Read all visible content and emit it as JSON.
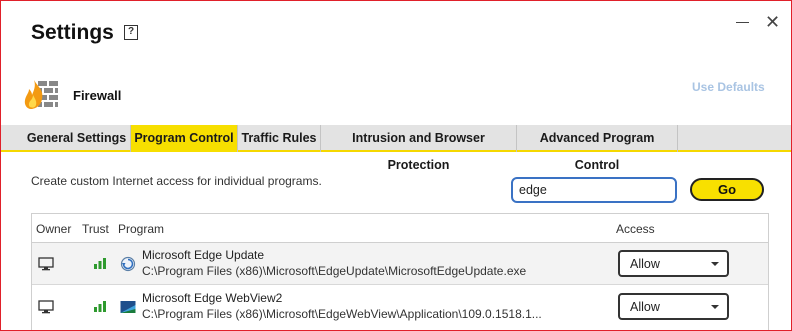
{
  "window": {
    "title": "Settings",
    "help_glyph": "?",
    "close_glyph": "✕"
  },
  "section": {
    "title": "Firewall",
    "use_defaults": "Use Defaults"
  },
  "tabs": [
    {
      "label": "General Settings"
    },
    {
      "label": "Program Control",
      "active": true
    },
    {
      "label": "Traffic Rules"
    },
    {
      "label": "Intrusion and Browser Protection"
    },
    {
      "label": "Advanced Program Control"
    }
  ],
  "program_control": {
    "description": "Create custom Internet access for individual programs.",
    "search": {
      "value": "edge",
      "placeholder": ""
    },
    "go_label": "Go",
    "columns": {
      "owner": "Owner",
      "trust": "Trust",
      "program": "Program",
      "access": "Access"
    },
    "rows": [
      {
        "owner_icon": "monitor-icon",
        "trust_icon": "signal-bars-icon",
        "program_icon": "edge-update-icon",
        "name": "Microsoft Edge Update",
        "path": "C:\\Program Files (x86)\\Microsoft\\EdgeUpdate\\MicrosoftEdgeUpdate.exe",
        "access": "Allow"
      },
      {
        "owner_icon": "monitor-icon",
        "trust_icon": "signal-bars-icon",
        "program_icon": "webview-icon",
        "name": "Microsoft Edge WebView2",
        "path": "C:\\Program Files (x86)\\Microsoft\\EdgeWebView\\Application\\109.0.1518.1...",
        "access": "Allow"
      }
    ]
  },
  "colors": {
    "accent_yellow": "#f7df00",
    "frame_red": "#e0202a",
    "link_blue": "#a9c4e3",
    "trust_green": "#2e9a2e",
    "search_border": "#3a72c4"
  }
}
